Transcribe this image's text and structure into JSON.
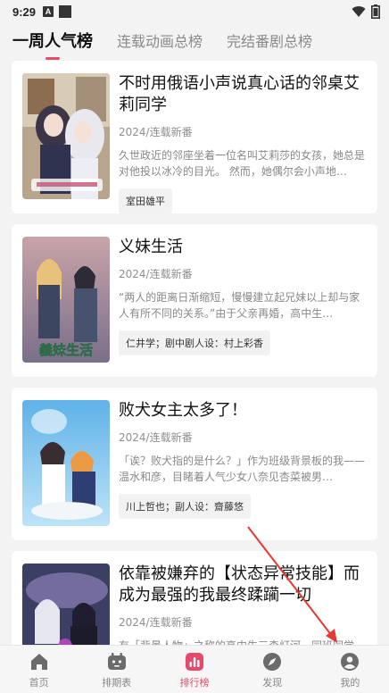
{
  "status_bar": {
    "time": "9:29",
    "icon_a": "A"
  },
  "tabs": [
    {
      "label": "一周人气榜",
      "active": true
    },
    {
      "label": "连载动画总榜",
      "active": false
    },
    {
      "label": "完结番剧总榜",
      "active": false
    }
  ],
  "anime": [
    {
      "title": "不时用俄语小声说真心话的邻桌艾莉同学",
      "meta": "2024/连载新番",
      "desc": "久世政近的邻座坐着一位名叫艾莉莎的女孩，她总是对他投以冰冷的目光。 然而，她偶尔会小声地…",
      "staff": "室田雄平"
    },
    {
      "title": "义妹生活",
      "meta": "2024/连载新番",
      "desc": "“两人的距离日渐缩短，慢慢建立起兄妹以上却与家人有所不同的关系。”由于父亲再婚，高中生…",
      "staff": "仁井学；剧中剧人设：村上彩香",
      "cover_text": "義妹生活"
    },
    {
      "title": "败犬女主太多了！",
      "meta": "2024/连载新番",
      "desc": "「诶？败犬指的是什么？」作为班级背景板的我——温水和彦，目睹着人气少女八奈见杏菜被男…",
      "staff": "川上哲也；副人设：齋藤悠"
    },
    {
      "title": "依靠被嫌弃的【状态异常技能】而成为最强的我最终蹂躏一切",
      "meta": "2024/连载新番",
      "desc": "有「背景人物」之称的高中生三森灯河，同班同学一起被召唤到异世界。同学陆续获得A级、S级…",
      "staff": ""
    }
  ],
  "bottom_nav": [
    {
      "label": "首页",
      "icon": "home-icon",
      "active": false
    },
    {
      "label": "排期表",
      "icon": "schedule-icon",
      "active": false
    },
    {
      "label": "排行榜",
      "icon": "ranking-icon",
      "active": true
    },
    {
      "label": "发现",
      "icon": "discover-icon",
      "active": false
    },
    {
      "label": "我的",
      "icon": "profile-icon",
      "active": false
    }
  ],
  "colors": {
    "accent": "#e7496b",
    "annotation": "#e53935"
  }
}
